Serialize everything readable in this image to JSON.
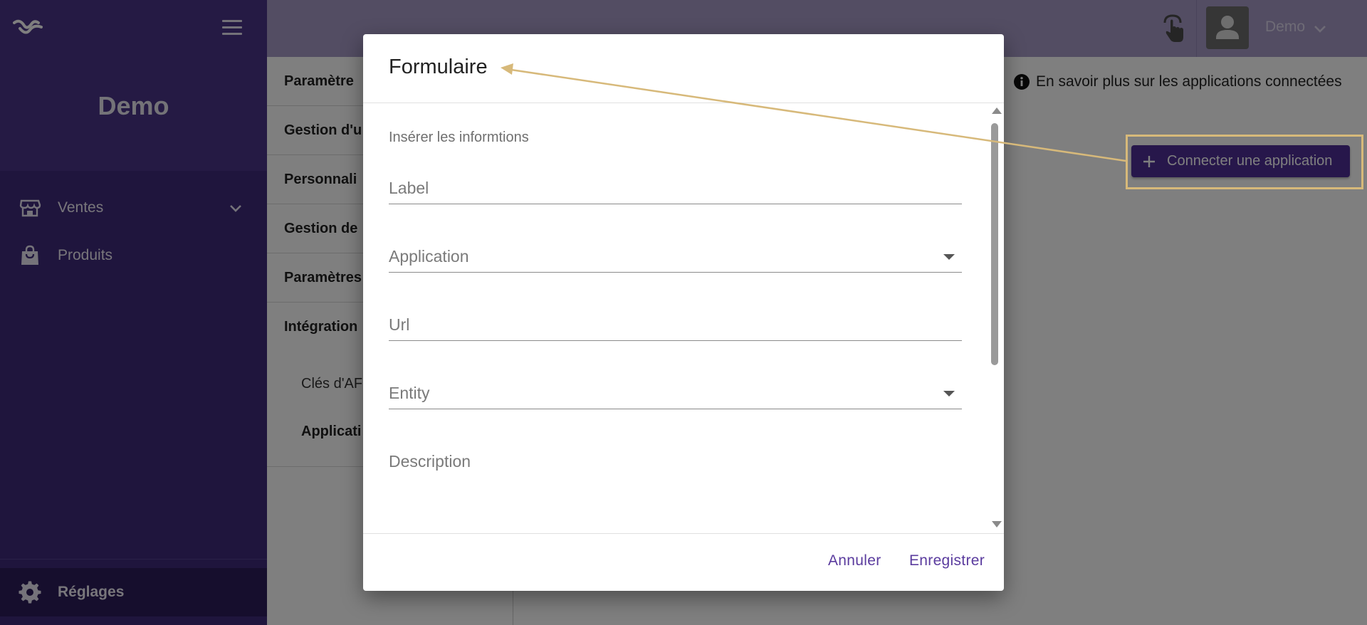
{
  "sidebar": {
    "company": "Demo",
    "items": [
      {
        "label": "Ventes"
      },
      {
        "label": "Produits"
      }
    ],
    "settings_label": "Réglages"
  },
  "topbar": {
    "user": "Demo"
  },
  "settings_menu": {
    "items": [
      {
        "label": "Paramètre"
      },
      {
        "label": "Gestion d'u"
      },
      {
        "label": "Personnali"
      },
      {
        "label": "Gestion de"
      },
      {
        "label": "Paramètres"
      },
      {
        "label": "Intégration"
      }
    ],
    "sub_items": [
      {
        "label": "Clés d'AF"
      },
      {
        "label": "Applicati"
      }
    ]
  },
  "main": {
    "learn_more": "En savoir plus sur les applications connectées",
    "connect_button": "Connecter une application"
  },
  "dialog": {
    "title": "Formulaire",
    "subtitle": "Insérer les informtions",
    "fields": {
      "label": {
        "placeholder": "Label"
      },
      "application": {
        "placeholder": "Application"
      },
      "url": {
        "placeholder": "Url"
      },
      "entity": {
        "placeholder": "Entity"
      },
      "description": {
        "placeholder": "Description"
      }
    },
    "cancel": "Annuler",
    "save": "Enregistrer"
  },
  "colors": {
    "sidebar": "#3f2a7a",
    "accent": "#4e2f96",
    "action_text": "#5a3b9e",
    "highlight": "#d7b97a"
  }
}
